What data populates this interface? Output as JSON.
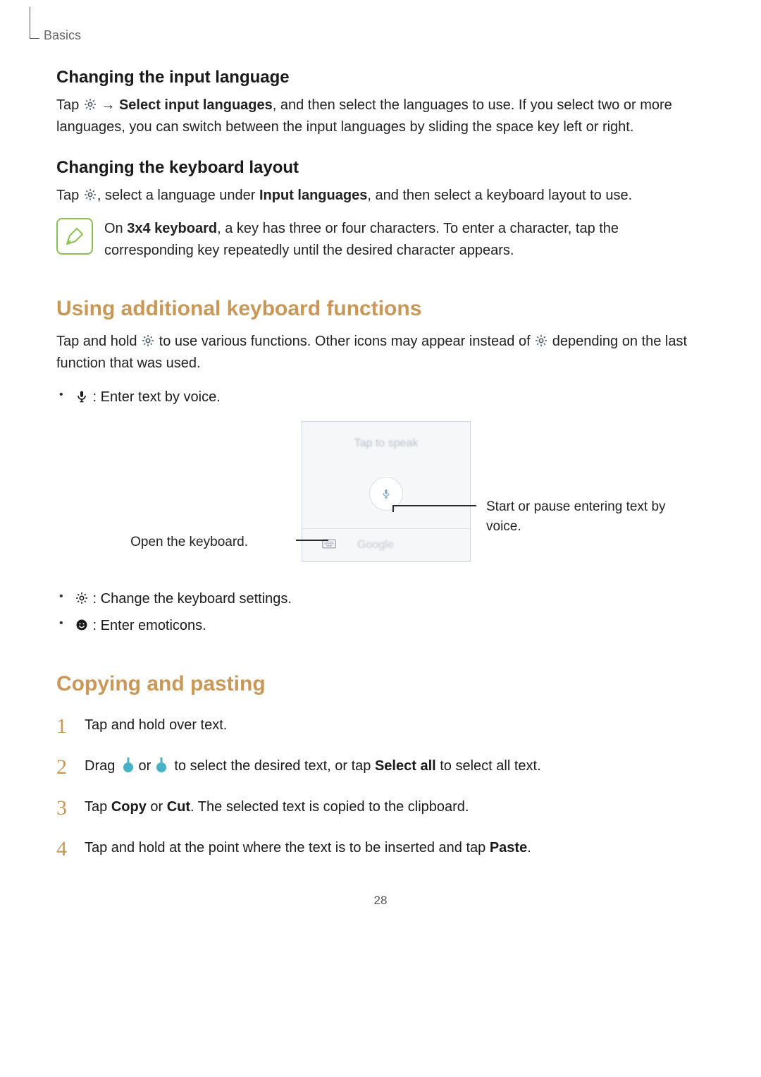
{
  "header": {
    "section": "Basics"
  },
  "sec1": {
    "title": "Changing the input language",
    "p1_a": "Tap ",
    "p1_arrow": " → ",
    "p1_bold": "Select input languages",
    "p1_b": ", and then select the languages to use. If you select two or more languages, you can switch between the input languages by sliding the space key left or right."
  },
  "sec2": {
    "title": "Changing the keyboard layout",
    "p1_a": "Tap ",
    "p1_b": ", select a language under ",
    "p1_bold": "Input languages",
    "p1_c": ", and then select a keyboard layout to use.",
    "note_a": "On ",
    "note_bold": "3x4 keyboard",
    "note_b": ", a key has three or four characters. To enter a character, tap the corresponding key repeatedly until the desired character appears."
  },
  "sec3": {
    "title": "Using additional keyboard functions",
    "p1_a": "Tap and hold ",
    "p1_b": " to use various functions. Other icons may appear instead of ",
    "p1_c": " depending on the last function that was used.",
    "bullet_mic": " : Enter text by voice.",
    "bullet_gear": " : Change the keyboard settings.",
    "bullet_smile": " : Enter emoticons.",
    "diagram": {
      "top_text": "Tap to speak",
      "google": "Google",
      "callout_left": "Open the keyboard.",
      "callout_right": "Start or pause entering text by voice."
    }
  },
  "sec4": {
    "title": "Copying and pasting",
    "step1": "Tap and hold over text.",
    "step2_a": "Drag ",
    "step2_b": " or ",
    "step2_c": " to select the desired text, or tap ",
    "step2_bold": "Select all",
    "step2_d": " to select all text.",
    "step3_a": "Tap ",
    "step3_b1": "Copy",
    "step3_c": " or ",
    "step3_b2": "Cut",
    "step3_d": ". The selected text is copied to the clipboard.",
    "step4_a": "Tap and hold at the point where the text is to be inserted and tap ",
    "step4_bold": "Paste",
    "step4_b": "."
  },
  "page_number": "28"
}
